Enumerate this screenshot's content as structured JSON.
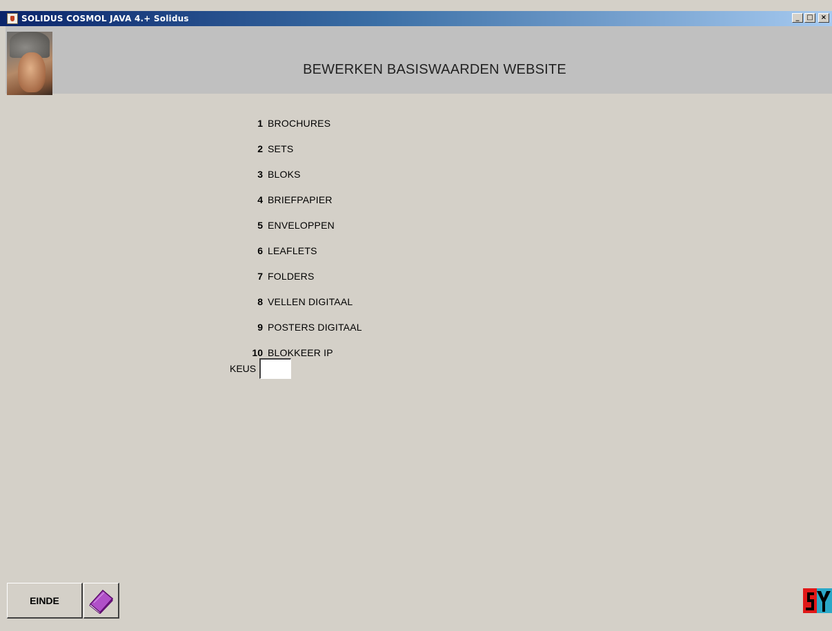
{
  "window": {
    "title": "SOLIDUS COSMOL JAVA 4.+ Solidus",
    "controls": {
      "minimize": "_",
      "maximize": "□",
      "close": "×"
    }
  },
  "header": {
    "title": "BEWERKEN BASISWAARDEN WEBSITE"
  },
  "menu": {
    "items": [
      {
        "num": "1",
        "label": "BROCHURES"
      },
      {
        "num": "2",
        "label": "SETS"
      },
      {
        "num": "3",
        "label": "BLOKS"
      },
      {
        "num": "4",
        "label": "BRIEFPAPIER"
      },
      {
        "num": "5",
        "label": "ENVELOPPEN"
      },
      {
        "num": "6",
        "label": "LEAFLETS"
      },
      {
        "num": "7",
        "label": "FOLDERS"
      },
      {
        "num": "8",
        "label": "VELLEN DIGITAAL"
      },
      {
        "num": "9",
        "label": "POSTERS DIGITAAL"
      },
      {
        "num": "10",
        "label": "BLOKKEER IP"
      }
    ],
    "choice_label": "KEUS",
    "choice_value": ""
  },
  "footer": {
    "einde_label": "EINDE",
    "book_icon": "book-icon",
    "logo_icon": "solidus-logo-icon"
  },
  "colors": {
    "background": "#d4d0c8",
    "header_band": "#c0c0c0",
    "titlebar_start": "#0a246a",
    "titlebar_end": "#a6caf0",
    "book_purple": "#9a1fb0"
  }
}
